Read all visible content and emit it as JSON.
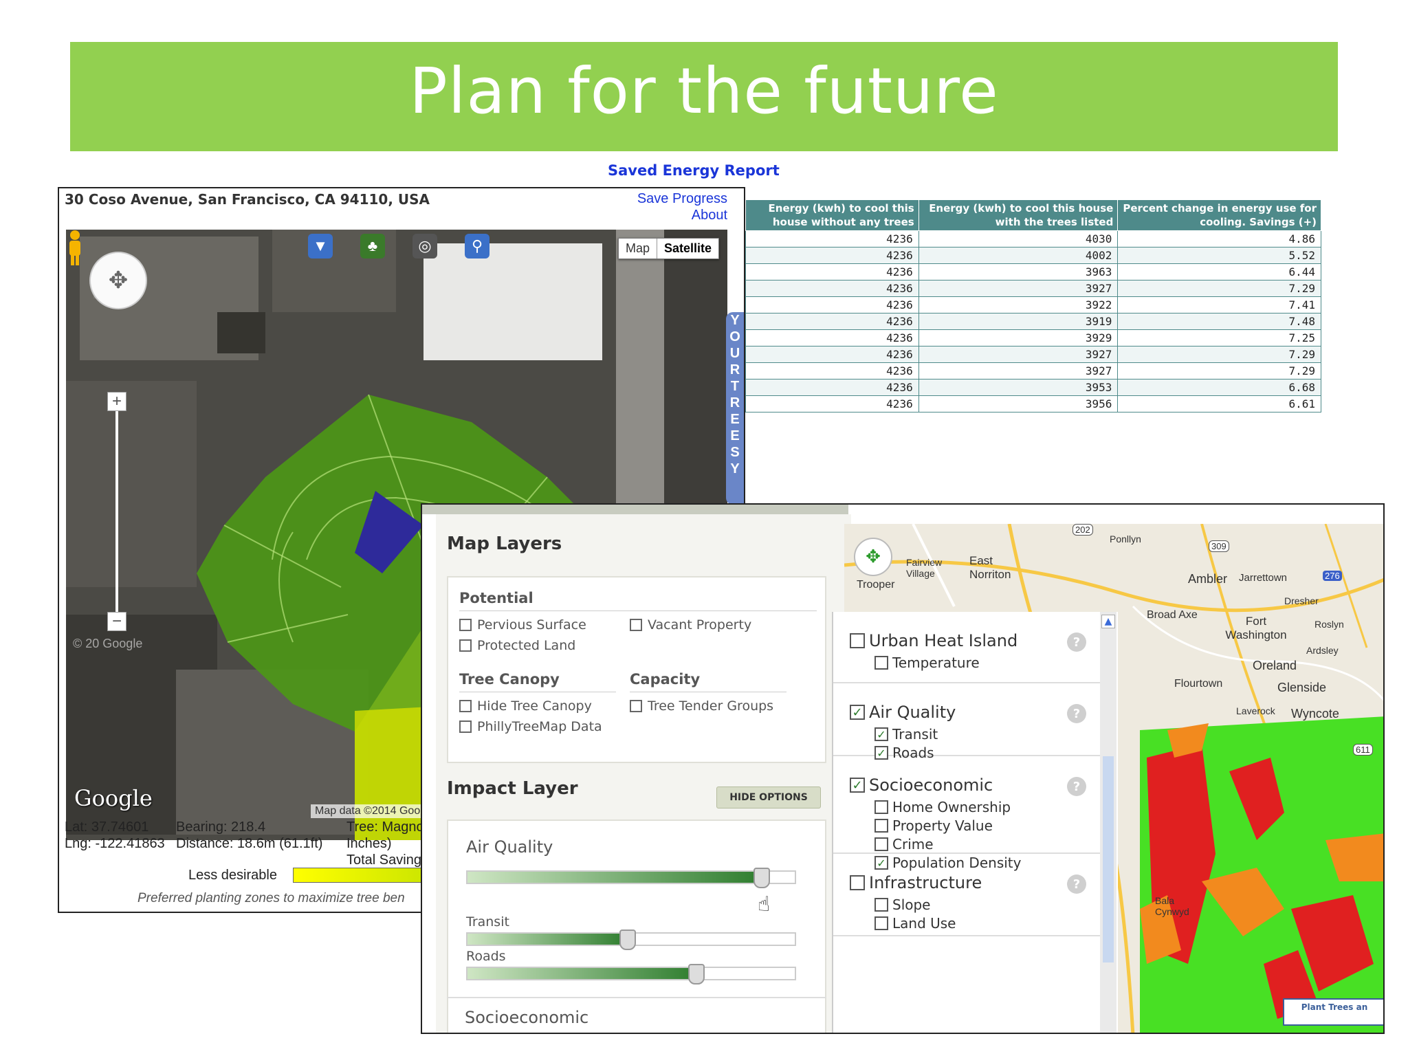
{
  "slide": {
    "title": "Plan for the future"
  },
  "report": {
    "title": "Saved Energy Report",
    "address": "30 Coso Avenue, San Francisco, CA 94110, USA",
    "links": {
      "save_progress": "Save Progress",
      "about": "About"
    },
    "map_type": {
      "map": "Map",
      "satellite": "Satellite"
    },
    "map_data_text": "Map data ©2014 Goo",
    "google_logo": "Google",
    "watermark": "© 20   Google",
    "your_trees_tab": "YOUR TREES Y",
    "info": {
      "lat": "Lat: 37.74601",
      "lng": "Lng: -122.41863",
      "bearing": "Bearing: 218.4",
      "distance": "Distance: 18.6m (61.1ft)",
      "tree": "Tree: Magno",
      "inches": "Inches)",
      "total": "Total Saving"
    },
    "legend_label": "Less desirable",
    "preferred_text": "Preferred planting zones to maximize tree ben",
    "icons": [
      "bucket-icon",
      "add-tree-icon",
      "target-icon",
      "magnifier-icon"
    ],
    "colors": {
      "canopy_green": "#4c9a14",
      "canopy_yellow": "#d4e000",
      "house_blue": "#2e2a9a"
    }
  },
  "energy_table": {
    "headers": [
      "Energy (kwh) to cool this house without any trees",
      "Energy (kwh) to cool this house with the trees listed",
      "Percent change in energy use for cooling. Savings (+)"
    ],
    "rows": [
      [
        "4236",
        "4030",
        "4.86"
      ],
      [
        "4236",
        "4002",
        "5.52"
      ],
      [
        "4236",
        "3963",
        "6.44"
      ],
      [
        "4236",
        "3927",
        "7.29"
      ],
      [
        "4236",
        "3922",
        "7.41"
      ],
      [
        "4236",
        "3919",
        "7.48"
      ],
      [
        "4236",
        "3929",
        "7.25"
      ],
      [
        "4236",
        "3927",
        "7.29"
      ],
      [
        "4236",
        "3927",
        "7.29"
      ],
      [
        "4236",
        "3953",
        "6.68"
      ],
      [
        "4236",
        "3956",
        "6.61"
      ]
    ]
  },
  "layers_panel": {
    "map_layers_title": "Map Layers",
    "potential": {
      "title": "Potential",
      "items": [
        {
          "label": "Pervious Surface",
          "checked": false
        },
        {
          "label": "Protected Land",
          "checked": false
        },
        {
          "label": "Vacant Property",
          "checked": false
        }
      ]
    },
    "tree_canopy": {
      "title": "Tree Canopy",
      "items": [
        {
          "label": "Hide Tree Canopy",
          "checked": false
        },
        {
          "label": "PhillyTreeMap Data",
          "checked": false
        }
      ]
    },
    "capacity": {
      "title": "Capacity",
      "items": [
        {
          "label": "Tree Tender Groups",
          "checked": false
        }
      ]
    },
    "impact_layer": {
      "title": "Impact Layer",
      "hide_options": "HIDE OPTIONS",
      "sliders": [
        {
          "label": "Air Quality",
          "value": 0.9
        },
        {
          "label": "Transit",
          "value": 0.49
        },
        {
          "label": "Roads",
          "value": 0.7
        }
      ],
      "socioeconomic_label": "Socioeconomic"
    },
    "checklist": [
      {
        "title": "Urban Heat Island",
        "checked": false,
        "help": "?",
        "subs": [
          {
            "label": "Temperature",
            "checked": false
          }
        ]
      },
      {
        "title": "Air Quality",
        "checked": true,
        "help": "?",
        "subs": [
          {
            "label": "Transit",
            "checked": true
          },
          {
            "label": "Roads",
            "checked": true
          }
        ]
      },
      {
        "title": "Socioeconomic",
        "checked": true,
        "help": "?",
        "subs": [
          {
            "label": "Home Ownership",
            "checked": false
          },
          {
            "label": "Property Value",
            "checked": false
          },
          {
            "label": "Crime",
            "checked": false
          },
          {
            "label": "Population Density",
            "checked": true
          }
        ]
      },
      {
        "title": "Infrastructure",
        "checked": false,
        "help": "?",
        "subs": [
          {
            "label": "Slope",
            "checked": false
          },
          {
            "label": "Land Use",
            "checked": false
          }
        ]
      }
    ],
    "check_mark": "✓",
    "map_places": {
      "fairview": "Fairview Village",
      "east_norriton": "East Norriton",
      "trooper": "Trooper",
      "ambler": "Ambler",
      "jarrettown": "Jarrettown",
      "dresher": "Dresher",
      "broad_axe": "Broad Axe",
      "fort_washington": "Fort Washington",
      "roslyn": "Roslyn",
      "ardsley": "Ardsley",
      "oreland": "Oreland",
      "flourtown": "Flourtown",
      "glenside": "Glenside",
      "wyncote": "Wyncote",
      "laverock": "Laverock",
      "bala_cynwyd": "Bala Cynwyd",
      "ponllyn": "Ponllyn",
      "route_202": "202",
      "route_309": "309",
      "route_611": "611",
      "route_276": "276"
    },
    "plant_trees": "Plant Trees an"
  }
}
